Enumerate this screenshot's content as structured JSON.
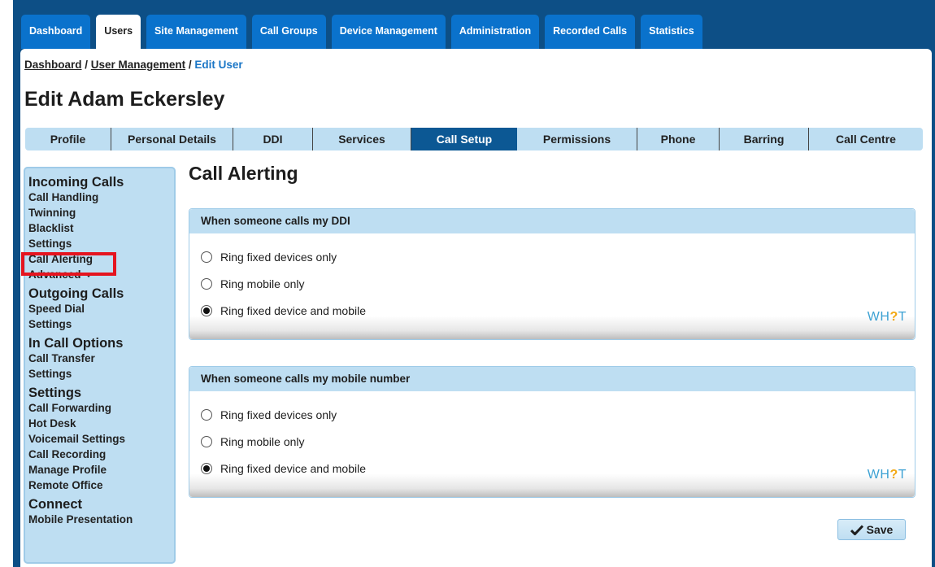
{
  "top_nav": {
    "tabs": [
      {
        "label": "Dashboard"
      },
      {
        "label": "Users",
        "active": true
      },
      {
        "label": "Site Management"
      },
      {
        "label": "Call Groups"
      },
      {
        "label": "Device Management"
      },
      {
        "label": "Administration"
      },
      {
        "label": "Recorded Calls"
      },
      {
        "label": "Statistics"
      }
    ]
  },
  "breadcrumb": {
    "items": [
      "Dashboard",
      "User Management"
    ],
    "separator": " / ",
    "current": "Edit User"
  },
  "page_title": "Edit Adam Eckersley",
  "sub_tabs": [
    {
      "label": "Profile"
    },
    {
      "label": "Personal Details"
    },
    {
      "label": "DDI"
    },
    {
      "label": "Services"
    },
    {
      "label": "Call Setup",
      "active": true
    },
    {
      "label": "Permissions"
    },
    {
      "label": "Phone"
    },
    {
      "label": "Barring"
    },
    {
      "label": "Call Centre"
    }
  ],
  "sidebar": {
    "incoming": {
      "heading": "Incoming Calls",
      "links": [
        "Call Handling",
        "Twinning",
        "Blacklist",
        "Settings",
        "Call Alerting"
      ],
      "advanced": "Advanced"
    },
    "outgoing": {
      "heading": "Outgoing Calls",
      "links": [
        "Speed Dial",
        "Settings"
      ]
    },
    "in_call": {
      "heading": "In Call Options",
      "links": [
        "Call Transfer",
        "Settings"
      ]
    },
    "settings": {
      "heading": "Settings",
      "links": [
        "Call Forwarding",
        "Hot Desk",
        "Voicemail Settings",
        "Call Recording",
        "Manage Profile",
        "Remote Office"
      ]
    },
    "connect": {
      "heading": "Connect",
      "links": [
        "Mobile Presentation"
      ]
    }
  },
  "main": {
    "title": "Call Alerting",
    "panels": [
      {
        "header": "When someone calls my DDI",
        "options": [
          {
            "label": "Ring fixed devices only",
            "selected": false
          },
          {
            "label": "Ring mobile only",
            "selected": false
          },
          {
            "label": "Ring fixed device and mobile",
            "selected": true
          }
        ],
        "logo": {
          "left": "WH",
          "q": "?",
          "right": "T"
        }
      },
      {
        "header": "When someone calls my mobile number",
        "options": [
          {
            "label": "Ring fixed devices only",
            "selected": false
          },
          {
            "label": "Ring mobile only",
            "selected": false
          },
          {
            "label": "Ring fixed device and mobile",
            "selected": true
          }
        ],
        "logo": {
          "left": "WH",
          "q": "?",
          "right": "T"
        }
      }
    ],
    "save_label": "Save"
  },
  "colors": {
    "nav_bg": "#0d4f86",
    "tab_blue": "#0a72cc",
    "light_blue": "#bedef2",
    "active_subtab": "#0c5894",
    "highlight": "#e5141f"
  }
}
